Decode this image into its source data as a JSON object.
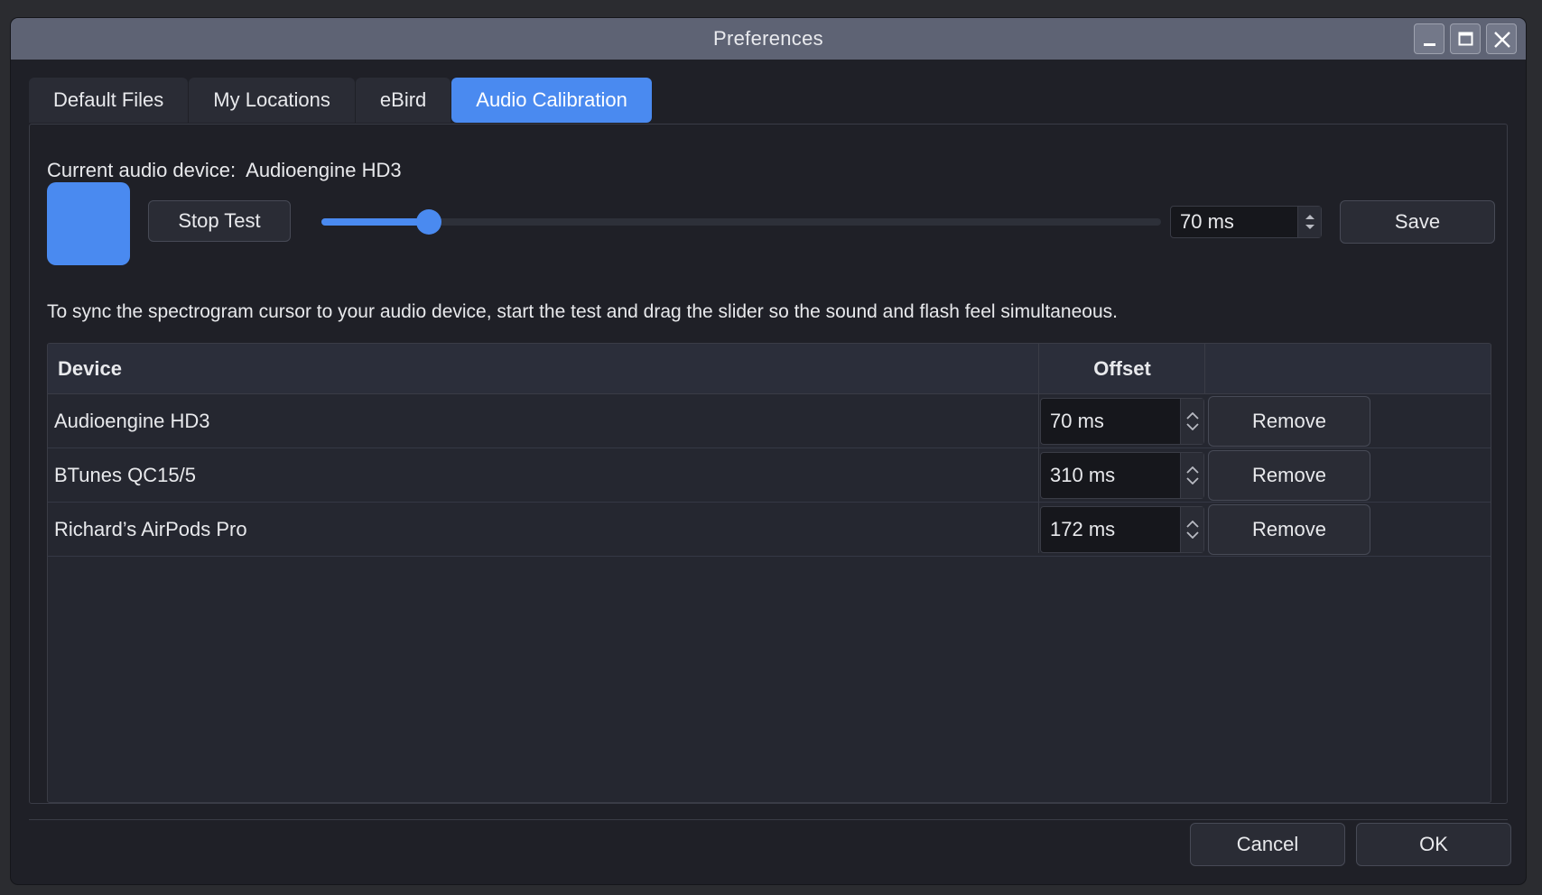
{
  "window": {
    "title": "Preferences"
  },
  "tabs": [
    {
      "label": "Default Files",
      "active": false
    },
    {
      "label": "My Locations",
      "active": false
    },
    {
      "label": "eBird",
      "active": false
    },
    {
      "label": "Audio Calibration",
      "active": true
    }
  ],
  "device": {
    "prefix": "Current audio device:",
    "name": "Audioengine HD3"
  },
  "test": {
    "stop_label": "Stop Test",
    "slider_fraction": 0.128,
    "offset_value": "70 ms",
    "save_label": "Save"
  },
  "hint": "To sync the spectrogram cursor to your audio device, start the test and drag the slider so the sound and flash feel simultaneous.",
  "table": {
    "headers": {
      "device": "Device",
      "offset": "Offset"
    },
    "rows": [
      {
        "device": "Audioengine HD3",
        "offset": "70 ms",
        "remove": "Remove"
      },
      {
        "device": "BTunes QC15/5",
        "offset": "310 ms",
        "remove": "Remove"
      },
      {
        "device": "Richard’s AirPods Pro",
        "offset": "172 ms",
        "remove": "Remove"
      }
    ]
  },
  "footer": {
    "cancel_label": "Cancel",
    "ok_label": "OK"
  },
  "colors": {
    "accent": "#4a8af0",
    "background": "#1f2027",
    "titlebar": "#5e6374"
  }
}
